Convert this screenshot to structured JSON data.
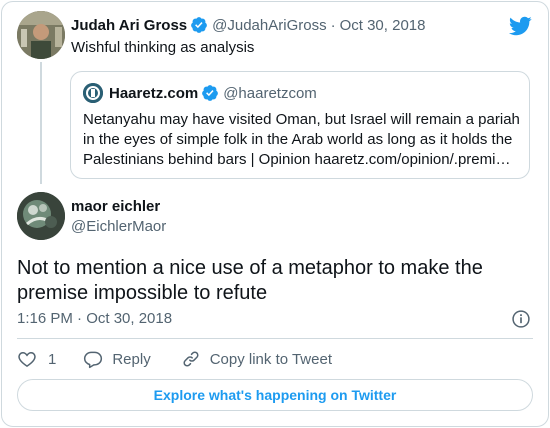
{
  "parent_tweet": {
    "display_name": "Judah Ari Gross",
    "handle": "@JudahAriGross",
    "separator": "·",
    "date": "Oct 30, 2018",
    "text": "Wishful thinking as analysis"
  },
  "quote_tweet": {
    "display_name": "Haaretz.com",
    "handle": "@haaretzcom",
    "text": "Netanyahu may have visited Oman, but Israel will remain a pariah in the eyes of simple folk in the Arab world as long as it holds the Palestinians behind bars | Opinion haaretz.com/opinion/.premi…"
  },
  "main_tweet": {
    "display_name": "maor eichler",
    "handle": "@EichlerMaor",
    "text": "Not to mention a nice use of a metaphor to make the premise impossible to refute",
    "timestamp": "1:16 PM · Oct 30, 2018"
  },
  "actions": {
    "like_count": "1",
    "reply_label": "Reply",
    "copy_link_label": "Copy link to Tweet"
  },
  "explore_label": "Explore what's happening on Twitter",
  "icons": {
    "verified": "verified-badge-icon",
    "brand": "twitter-bird-icon",
    "info": "info-icon",
    "like": "heart-icon",
    "reply": "speech-bubble-icon",
    "copy_link": "link-icon"
  },
  "colors": {
    "brand_blue": "#1d9bf0",
    "secondary_text": "#536471",
    "border": "#cfd9de"
  }
}
